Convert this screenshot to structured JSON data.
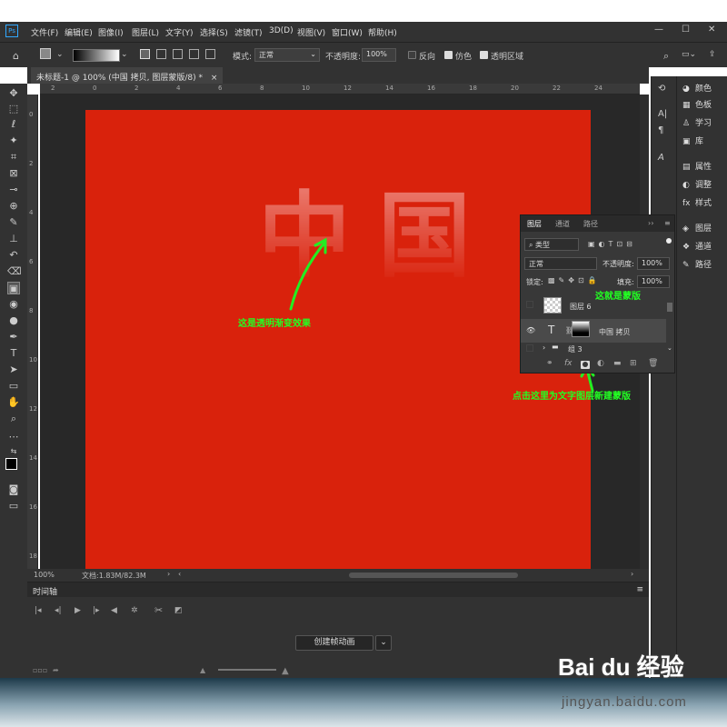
{
  "app": {
    "logo": "Ps"
  },
  "menu": [
    "文件(F)",
    "编辑(E)",
    "图像(I)",
    "图层(L)",
    "文字(Y)",
    "选择(S)",
    "滤镜(T)",
    "3D(D)",
    "视图(V)",
    "窗口(W)",
    "帮助(H)"
  ],
  "window_controls": [
    "—",
    "☐",
    "✕"
  ],
  "options": {
    "mode_label": "模式:",
    "mode_value": "正常",
    "opacity_label": "不透明度:",
    "opacity_value": "100%",
    "reverse": "反向",
    "dither": "仿色",
    "transparency": "透明区域",
    "reverse_checked": false,
    "dither_checked": true,
    "transparency_checked": true
  },
  "document": {
    "tab_title": "未标题-1 @ 100% (中国 拷贝, 图层蒙版/8) *",
    "tab_close": "×",
    "ghost_text_1": "中",
    "ghost_text_2": "国",
    "canvas_color": "#d9220c"
  },
  "ruler_h": [
    "2",
    "0",
    "2",
    "4",
    "6",
    "8",
    "10",
    "12",
    "14",
    "16",
    "18",
    "20",
    "22",
    "24"
  ],
  "ruler_v": [
    "0",
    "2",
    "4",
    "6",
    "8",
    "10",
    "12",
    "14",
    "16",
    "18"
  ],
  "annotations": {
    "gradient_effect": "这是透明渐变效果",
    "mask_here": "这就是蒙版",
    "click_here": "点击这里为文字图层新建蒙版"
  },
  "status": {
    "zoom": "100%",
    "doc_info": "文档:1.83M/82.3M"
  },
  "timeline": {
    "title": "时间轴",
    "create_button": "创建帧动画"
  },
  "dock_right": [
    {
      "icon": "color-icon",
      "glyph": "◕",
      "label": "颜色"
    },
    {
      "icon": "swatches-icon",
      "glyph": "▦",
      "label": "色板"
    },
    {
      "icon": "learn-icon",
      "glyph": "♙",
      "label": "学习"
    },
    {
      "icon": "library-icon",
      "glyph": "▣",
      "label": "库"
    },
    {
      "icon": "properties-icon",
      "glyph": "▤",
      "label": "属性"
    },
    {
      "icon": "adjustments-icon",
      "glyph": "◐",
      "label": "调整"
    },
    {
      "icon": "styles-icon",
      "glyph": "fx",
      "label": "样式"
    },
    {
      "icon": "layers-icon",
      "glyph": "◈",
      "label": "图层"
    },
    {
      "icon": "channels-icon",
      "glyph": "❖",
      "label": "通道"
    },
    {
      "icon": "paths-icon",
      "glyph": "✎",
      "label": "路径"
    }
  ],
  "layers_panel": {
    "tabs": [
      "图层",
      "通道",
      "路径"
    ],
    "filter_label": "类型",
    "blend_mode": "正常",
    "opacity_label": "不透明度:",
    "opacity_value": "100%",
    "lock_label": "锁定:",
    "fill_label": "填充:",
    "fill_value": "100%",
    "layers": [
      {
        "name": "图层 6",
        "type": "pixel",
        "visible": false
      },
      {
        "name": "中国 拷贝",
        "type": "text",
        "visible": true,
        "selected": true
      },
      {
        "name": "组 3",
        "type": "group",
        "visible": false
      }
    ]
  },
  "watermark": {
    "brand": "Bai du 经验",
    "url": "jingyan.baidu.com"
  }
}
